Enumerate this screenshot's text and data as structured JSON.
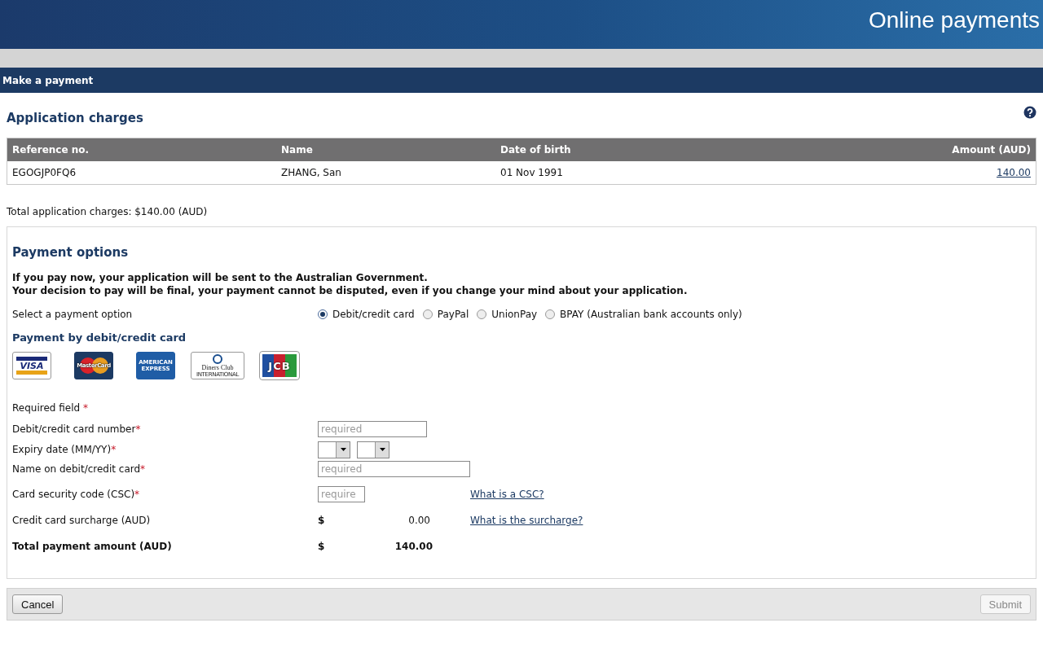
{
  "header": {
    "title": "Online payments"
  },
  "section_bar": {
    "title": "Make a payment"
  },
  "charges": {
    "title": "Application charges",
    "table": {
      "columns": [
        {
          "label": "Reference no."
        },
        {
          "label": "Name"
        },
        {
          "label": "Date of birth"
        },
        {
          "label": "Amount (AUD)"
        }
      ],
      "rows": [
        [
          "EGOGJP0FQ6",
          "ZHANG, San",
          "01 Nov 1991",
          "140.00"
        ]
      ]
    },
    "total": "Total application charges: $140.00 (AUD)"
  },
  "payment_options": {
    "title": "Payment options",
    "notice": [
      "If you pay now, your application will be sent to the Australian Government.",
      "Your decision to pay will be final, your payment cannot be disputed, even if you change your mind about your application."
    ],
    "select_label": "Select a payment option",
    "options": [
      {
        "label": "Debit/credit card",
        "selected": true
      },
      {
        "label": "PayPal",
        "selected": false
      },
      {
        "label": "UnionPay",
        "selected": false
      },
      {
        "label": "BPAY (Australian bank accounts only)",
        "selected": false
      }
    ],
    "card_title": "Payment by debit/credit card",
    "card_logos": [
      {
        "kind": "visa",
        "text": "VISA"
      },
      {
        "kind": "mastercard",
        "text": "MasterCard"
      },
      {
        "kind": "amex",
        "text": "AMERICAN EXPRESS"
      },
      {
        "kind": "diners",
        "text": "Diners Club",
        "subtext": "INTERNATIONAL"
      },
      {
        "kind": "jcb",
        "text": "JCB"
      }
    ],
    "required_note": {
      "label": "Required field",
      "mark": "*"
    },
    "fields": [
      {
        "kind": "text",
        "label": "Debit/credit card number",
        "mark": "*",
        "placeholder": "required"
      },
      {
        "kind": "selects",
        "label": "Expiry date (MM/YY)",
        "mark": "*"
      },
      {
        "kind": "text",
        "label": "Name on debit/credit card",
        "mark": "*",
        "placeholder": "required"
      },
      {
        "kind": "text",
        "label": "Card security code (CSC)",
        "mark": "*",
        "placeholder": "require",
        "link": "What is a CSC?"
      },
      {
        "kind": "amount",
        "label": "Credit card surcharge (AUD)",
        "currency": "$",
        "value": "0.00",
        "link": "What is the surcharge?"
      },
      {
        "kind": "total",
        "label": "Total payment amount (AUD)",
        "currency": "$",
        "value": "140.00"
      }
    ]
  },
  "buttons": [
    {
      "label": "Cancel",
      "disabled": false
    },
    {
      "label": "Submit",
      "disabled": true
    }
  ]
}
